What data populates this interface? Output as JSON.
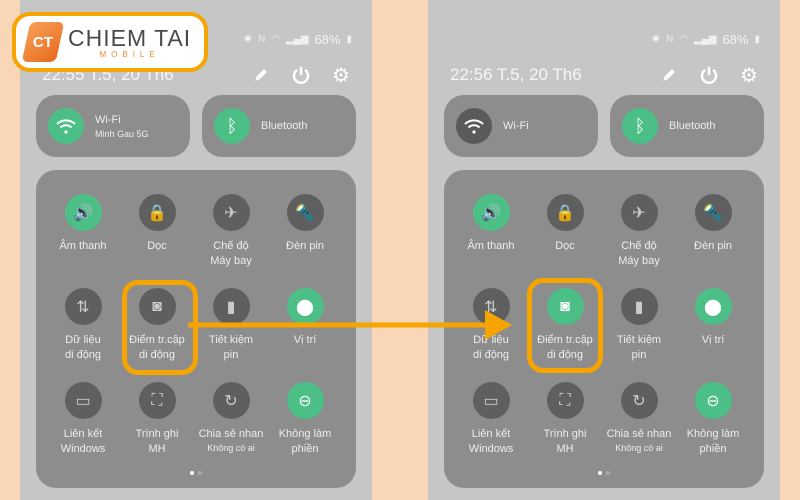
{
  "colors": {
    "accent": "#4cbf86",
    "off": "#5f5f5f",
    "highlight": "#f6a400",
    "background": "#f9d6b6"
  },
  "logo": {
    "mark": "CT",
    "main": "CHIEM TAI",
    "sub": "MOBILE"
  },
  "panels": [
    {
      "status": {
        "battery": "68%"
      },
      "time": "22:55 T.5, 20 Th6",
      "wifi": {
        "title": "Wi-Fi",
        "sub": "Minh Gau 5G",
        "on": true
      },
      "bluetooth": {
        "title": "Bluetooth",
        "on": true
      },
      "tiles": [
        {
          "icon": "sound-icon",
          "label": "Âm thanh",
          "on": true
        },
        {
          "icon": "portrait-lock-icon",
          "label": "Dọc",
          "on": false
        },
        {
          "icon": "airplane-icon",
          "label": "Chế độ\nMáy bay",
          "on": false
        },
        {
          "icon": "flashlight-icon",
          "label": "Đèn pin",
          "on": false
        },
        {
          "icon": "mobile-data-icon",
          "label": "Dữ liệu\ndi động",
          "on": false
        },
        {
          "icon": "hotspot-icon",
          "label": "Điểm tr.cập\ndi động",
          "on": false
        },
        {
          "icon": "battery-saver-icon",
          "label": "Tiết kiệm\npin",
          "on": false
        },
        {
          "icon": "location-icon",
          "label": "Vị trí",
          "on": true
        },
        {
          "icon": "link-windows-icon",
          "label": "Liên kết\nWindows",
          "on": false
        },
        {
          "icon": "screen-recorder-icon",
          "label": "Trình ghi\nMH",
          "on": false
        },
        {
          "icon": "quick-share-icon",
          "label": "Chia sẻ nhan",
          "sub": "Không có ai",
          "on": false
        },
        {
          "icon": "do-not-disturb-icon",
          "label": "Không làm\nphiền",
          "on": true
        }
      ]
    },
    {
      "status": {
        "battery": "68%"
      },
      "time": "22:56 T.5, 20 Th6",
      "wifi": {
        "title": "Wi-Fi",
        "sub": "",
        "on": false
      },
      "bluetooth": {
        "title": "Bluetooth",
        "on": true
      },
      "tiles": [
        {
          "icon": "sound-icon",
          "label": "Âm thanh",
          "on": true
        },
        {
          "icon": "portrait-lock-icon",
          "label": "Dọc",
          "on": false
        },
        {
          "icon": "airplane-icon",
          "label": "Chế độ\nMáy bay",
          "on": false
        },
        {
          "icon": "flashlight-icon",
          "label": "Đèn pin",
          "on": false
        },
        {
          "icon": "mobile-data-icon",
          "label": "Dữ liệu\ndi động",
          "on": false
        },
        {
          "icon": "hotspot-icon",
          "label": "Điểm tr.cập\ndi động",
          "on": true
        },
        {
          "icon": "battery-saver-icon",
          "label": "Tiết kiệm\npin",
          "on": false
        },
        {
          "icon": "location-icon",
          "label": "Vị trí",
          "on": true
        },
        {
          "icon": "link-windows-icon",
          "label": "Liên kết\nWindows",
          "on": false
        },
        {
          "icon": "screen-recorder-icon",
          "label": "Trình ghi\nMH",
          "on": false
        },
        {
          "icon": "quick-share-icon",
          "label": "Chia sẻ nhan",
          "sub": "Không có ai",
          "on": false
        },
        {
          "icon": "do-not-disturb-icon",
          "label": "Không làm\nphiền",
          "on": true
        }
      ]
    }
  ]
}
